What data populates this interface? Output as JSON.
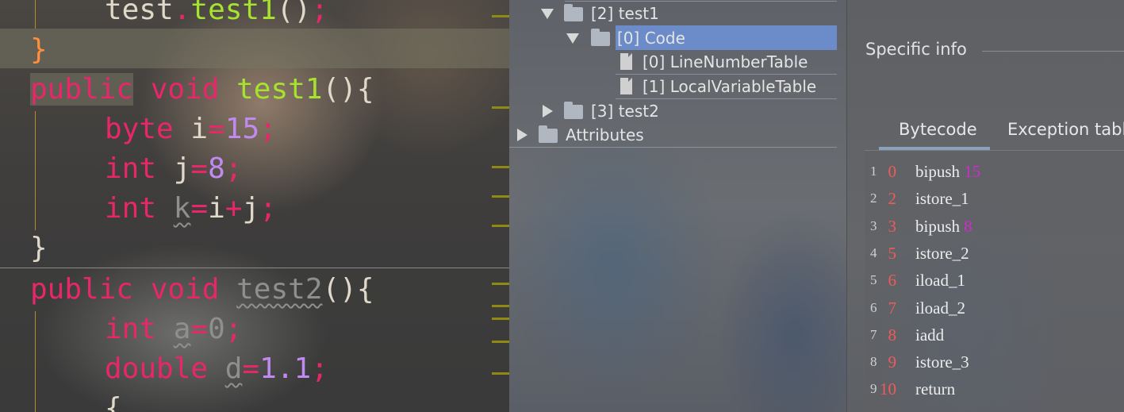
{
  "editor": {
    "lines": [
      {
        "id": "l0",
        "text": "test.test1();"
      },
      {
        "id": "l1",
        "text": "}"
      },
      {
        "id": "l2",
        "text": "public void test1(){"
      },
      {
        "id": "l3",
        "text": "byte i=15;"
      },
      {
        "id": "l4",
        "text": "int j=8;"
      },
      {
        "id": "l5",
        "text": "int k=i+j;"
      },
      {
        "id": "l6",
        "text": "}"
      },
      {
        "id": "l7",
        "text": "public void test2(){"
      },
      {
        "id": "l8",
        "text": "int a=0;"
      },
      {
        "id": "l9",
        "text": "double d=1.1;"
      },
      {
        "id": "l10",
        "text": "{"
      }
    ],
    "tokens": {
      "test": "test",
      "dot": ".",
      "test1": "test1",
      "paren": "()",
      "semi": ";",
      "brace_close": "}",
      "public": "public",
      "void": "void",
      "brace_open": "{",
      "byte": "byte",
      "i": "i",
      "eq": "=",
      "n15": "15",
      "int": "int",
      "j": "j",
      "n8": "8",
      "k": "k",
      "plus": "+",
      "test2": "test2",
      "a": "a",
      "n0": "0",
      "double": "double",
      "d": "d",
      "n11": "1.1"
    }
  },
  "tree": {
    "nodes": [
      {
        "label": "[2] test1"
      },
      {
        "label": "[0] Code"
      },
      {
        "label": "[0] LineNumberTable"
      },
      {
        "label": "[1] LocalVariableTable"
      },
      {
        "label": "[3] test2"
      },
      {
        "label": "Attributes"
      }
    ],
    "selected_color": "#6b8cc9"
  },
  "info": {
    "title": "Specific info",
    "tabs": [
      {
        "label": "Bytecode"
      },
      {
        "label": "Exception table"
      }
    ],
    "active_tab": "Bytecode",
    "bytecode": [
      {
        "line": "1",
        "offset": "0",
        "instr": "bipush",
        "arg": "15"
      },
      {
        "line": "2",
        "offset": "2",
        "instr": "istore_1",
        "arg": ""
      },
      {
        "line": "3",
        "offset": "3",
        "instr": "bipush",
        "arg": "8"
      },
      {
        "line": "4",
        "offset": "5",
        "instr": "istore_2",
        "arg": ""
      },
      {
        "line": "5",
        "offset": "6",
        "instr": "iload_1",
        "arg": ""
      },
      {
        "line": "6",
        "offset": "7",
        "instr": "iload_2",
        "arg": ""
      },
      {
        "line": "7",
        "offset": "8",
        "instr": "iadd",
        "arg": ""
      },
      {
        "line": "8",
        "offset": "9",
        "instr": "istore_3",
        "arg": ""
      },
      {
        "line": "9",
        "offset": "10",
        "instr": "return",
        "arg": ""
      }
    ]
  }
}
